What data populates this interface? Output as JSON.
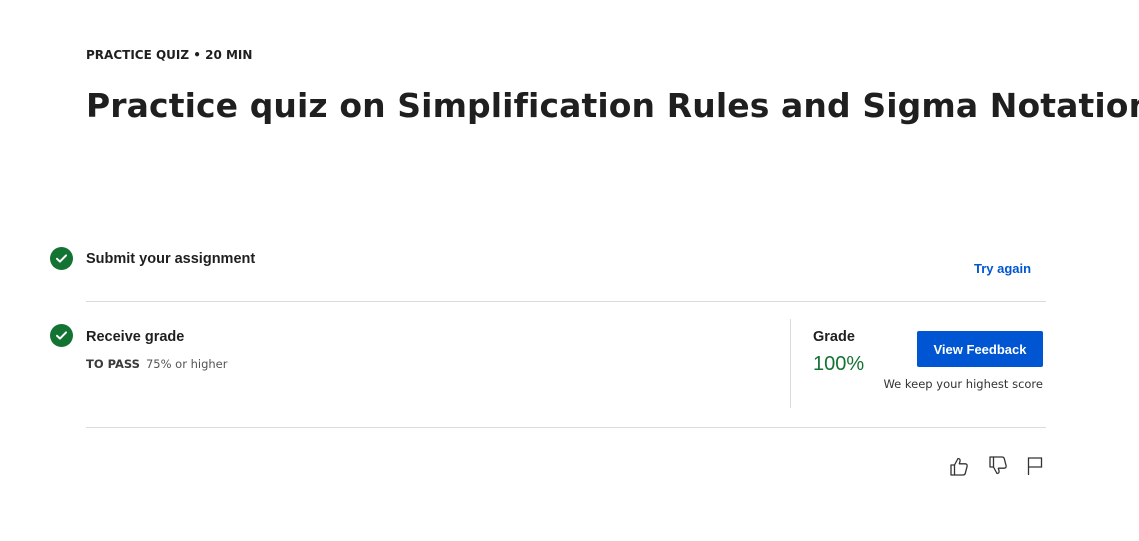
{
  "header": {
    "eyebrow": "PRACTICE QUIZ • 20 MIN",
    "title": "Practice quiz on Simplification Rules and Sigma Notation"
  },
  "steps": [
    {
      "label": "Submit your assignment",
      "status": "completed",
      "action_label": "Try again"
    },
    {
      "label": "Receive grade",
      "status": "completed",
      "pass_key": "TO PASS",
      "pass_value": "75% or higher"
    }
  ],
  "grade": {
    "label": "Grade",
    "value": "100%",
    "button_label": "View Feedback",
    "note": "We keep your highest score"
  },
  "footer_icons": [
    "thumbs-up-icon",
    "thumbs-down-icon",
    "flag-icon"
  ],
  "colors": {
    "accent": "#0056d2",
    "success": "#137333",
    "divider": "#dadce0",
    "text": "#1f1f1f"
  }
}
